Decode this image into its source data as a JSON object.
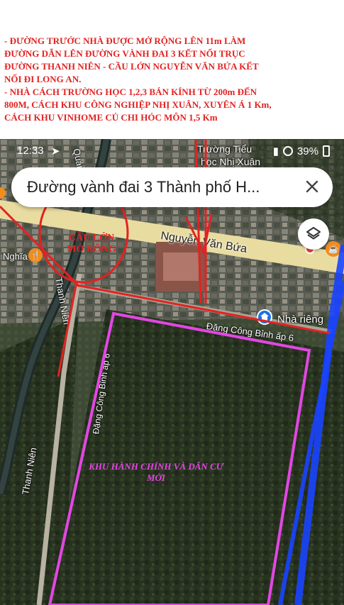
{
  "notes": {
    "line1": "- ĐƯỜNG TRƯỚC NHÀ ĐƯỢC MỞ RỘNG LÊN 11m LÀM",
    "line2": "ĐƯỜNG DẪN LÊN ĐƯỜNG VÀNH ĐAI 3 KẾT NỐI TRỤC",
    "line3": "ĐƯỜNG THANH NIÊN - CẦU LỚN NGUYỄN VĂN BỨA KẾT",
    "line4": "NỐI ĐI LONG AN.",
    "line5": "- NHÀ CÁCH TRƯỜNG HỌC 1,2,3 BÁN KÍNH TỪ 200m ĐẾN",
    "line6": "800M, CÁCH KHU CÔNG NGHIỆP NHỊ XUÂN, XUYÊN Á 1 Km,",
    "line7": "CÁCH KHU VINHOME CỦ CHI HÓC MÔN 1,5 Km"
  },
  "status_bar": {
    "time": "12:33",
    "battery": "39%"
  },
  "search": {
    "query": "Đường vành đai 3 Thành phố H..."
  },
  "map_labels": {
    "school_1": "Trường Tiểu",
    "school_2": "học Nhị Xuân",
    "road_nvb": "Nguyễn Văn Bứa",
    "nghia": "Nghĩa",
    "home": "Nhà riêng",
    "road_dcb": "Đặng Công Bỉnh ấp 6",
    "road_dcb_vertical": "Đặng Công Bỉnh ấp 6",
    "thanh_nien_upper": "Thanh Niên",
    "thanh_nien_lower": "Thanh Niên",
    "road_top": "Quán Th"
  },
  "annotations": {
    "bridge_1": "CẦU LỚN",
    "bridge_2": "MỞ RỘNG",
    "zone_1": "KHU HÀNH CHÍNH VÀ DÂN CƯ",
    "zone_2": "MỚI"
  },
  "colors": {
    "annotation_red": "#e32222",
    "zone_pink": "#e247e2",
    "ring_road_blue": "#1a44ff",
    "road_yellow": "#e9dca0"
  },
  "icons": {
    "layers": "layers-icon",
    "close": "close-icon",
    "home": "home-icon",
    "restaurant": "restaurant-icon",
    "cafe": "cafe-icon"
  }
}
